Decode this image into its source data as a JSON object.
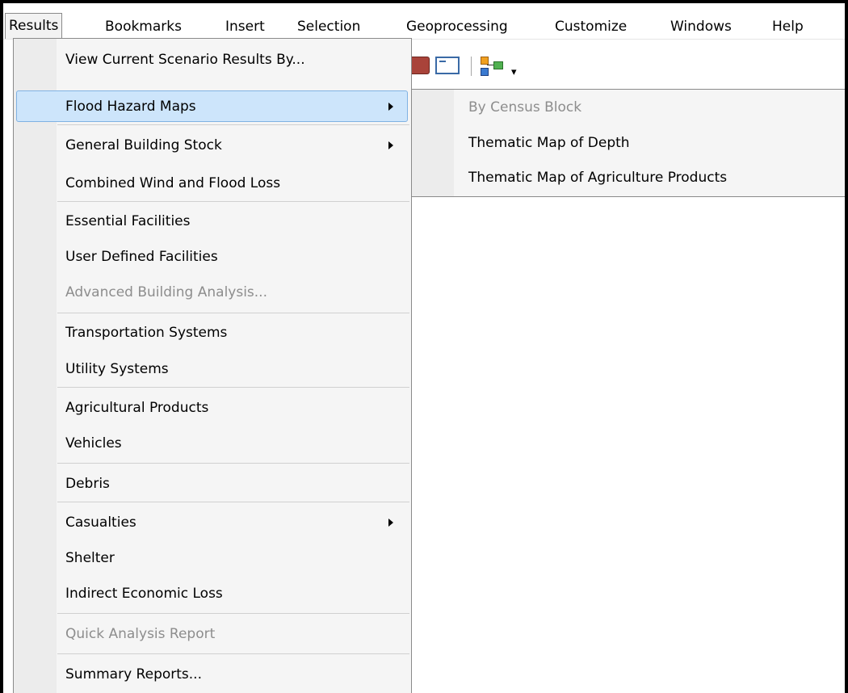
{
  "menubar": {
    "items": [
      {
        "label": "Results",
        "active": true
      },
      {
        "label": "Bookmarks"
      },
      {
        "label": "Insert"
      },
      {
        "label": "Selection"
      },
      {
        "label": "Geoprocessing"
      },
      {
        "label": "Customize"
      },
      {
        "label": "Windows"
      },
      {
        "label": "Help"
      }
    ]
  },
  "toolbar": {
    "icons": [
      "arcgis-tool-icon",
      "python-console-icon",
      "model-builder-icon",
      "toolbar-overflow-icon"
    ],
    "overflow_glyph": "▾"
  },
  "results_menu": {
    "items": [
      {
        "label": "View Current Scenario Results By...",
        "enabled": true
      },
      {
        "label": "Flood Hazard Maps",
        "enabled": true,
        "submenu": true,
        "highlighted": true
      },
      {
        "label": "General Building Stock",
        "enabled": true,
        "submenu": true
      },
      {
        "label": "Combined Wind and Flood Loss",
        "enabled": true
      },
      {
        "label": "Essential Facilities",
        "enabled": true
      },
      {
        "label": "User Defined Facilities",
        "enabled": true
      },
      {
        "label": "Advanced Building Analysis...",
        "enabled": false
      },
      {
        "label": "Transportation Systems",
        "enabled": true
      },
      {
        "label": "Utility Systems",
        "enabled": true
      },
      {
        "label": "Agricultural Products",
        "enabled": true
      },
      {
        "label": "Vehicles",
        "enabled": true
      },
      {
        "label": "Debris",
        "enabled": true
      },
      {
        "label": "Casualties",
        "enabled": true,
        "submenu": true
      },
      {
        "label": "Shelter",
        "enabled": true
      },
      {
        "label": "Indirect Economic Loss",
        "enabled": true
      },
      {
        "label": "Quick Analysis Report",
        "enabled": false
      },
      {
        "label": "Summary Reports...",
        "enabled": true
      }
    ]
  },
  "flood_hazard_submenu": {
    "items": [
      {
        "label": "By Census Block",
        "enabled": false
      },
      {
        "label": "Thematic Map of Depth",
        "enabled": true
      },
      {
        "label": "Thematic Map of Agriculture Products",
        "enabled": true
      }
    ]
  },
  "colors": {
    "highlight_fill": "#cde5fb",
    "highlight_border": "#80b2e3",
    "disabled_text": "#8d8d8d",
    "menu_background": "#f5f5f5"
  }
}
